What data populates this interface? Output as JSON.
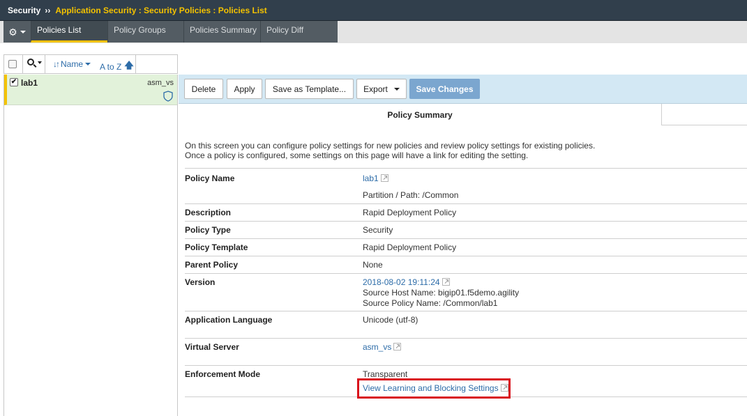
{
  "header": {
    "root": "Security",
    "separator": "››",
    "path": "Application Security : Security Policies : Policies List"
  },
  "tabs": [
    {
      "label": "Policies List",
      "active": true
    },
    {
      "label": "Policy Groups"
    },
    {
      "label": "Policies Summary"
    },
    {
      "label": "Policy Diff"
    }
  ],
  "list_toolbar": {
    "sort_field": "Name",
    "sort_order": "A to Z"
  },
  "policies": [
    {
      "name": "lab1",
      "virtual_server": "asm_vs",
      "checked": true
    }
  ],
  "actions": {
    "delete": "Delete",
    "apply": "Apply",
    "save_template": "Save as Template...",
    "export": "Export",
    "save_changes": "Save Changes"
  },
  "summary_tab": "Policy Summary",
  "intro_line1": "On this screen you can configure policy settings for new policies and review policy settings for existing policies.",
  "intro_line2": "Once a policy is configured, some settings on this page will have a link for editing the setting.",
  "fields": {
    "policy_name": {
      "label": "Policy Name",
      "value": "lab1",
      "sub": "Partition / Path: /Common"
    },
    "description": {
      "label": "Description",
      "value": "Rapid Deployment Policy"
    },
    "policy_type": {
      "label": "Policy Type",
      "value": "Security"
    },
    "policy_template": {
      "label": "Policy Template",
      "value": "Rapid Deployment Policy"
    },
    "parent_policy": {
      "label": "Parent Policy",
      "value": "None"
    },
    "version": {
      "label": "Version",
      "value": "2018-08-02 19:11:24",
      "source_host": "Source Host Name: bigip01.f5demo.agility",
      "source_policy": "Source Policy Name: /Common/lab1"
    },
    "app_language": {
      "label": "Application Language",
      "value": "Unicode (utf-8)"
    },
    "virtual_server": {
      "label": "Virtual Server",
      "value": "asm_vs"
    },
    "enforcement_mode": {
      "label": "Enforcement Mode",
      "value": "Transparent",
      "link": "View Learning and Blocking Settings"
    }
  },
  "colors": {
    "header_bg": "#313f4c",
    "breadcrumb_accent": "#f3c200",
    "link": "#2d6ca8",
    "selected_row": "#e2f2da",
    "action_bar": "#d3e8f4",
    "save_button": "#7ba6cf",
    "highlight": "#d9111b"
  }
}
